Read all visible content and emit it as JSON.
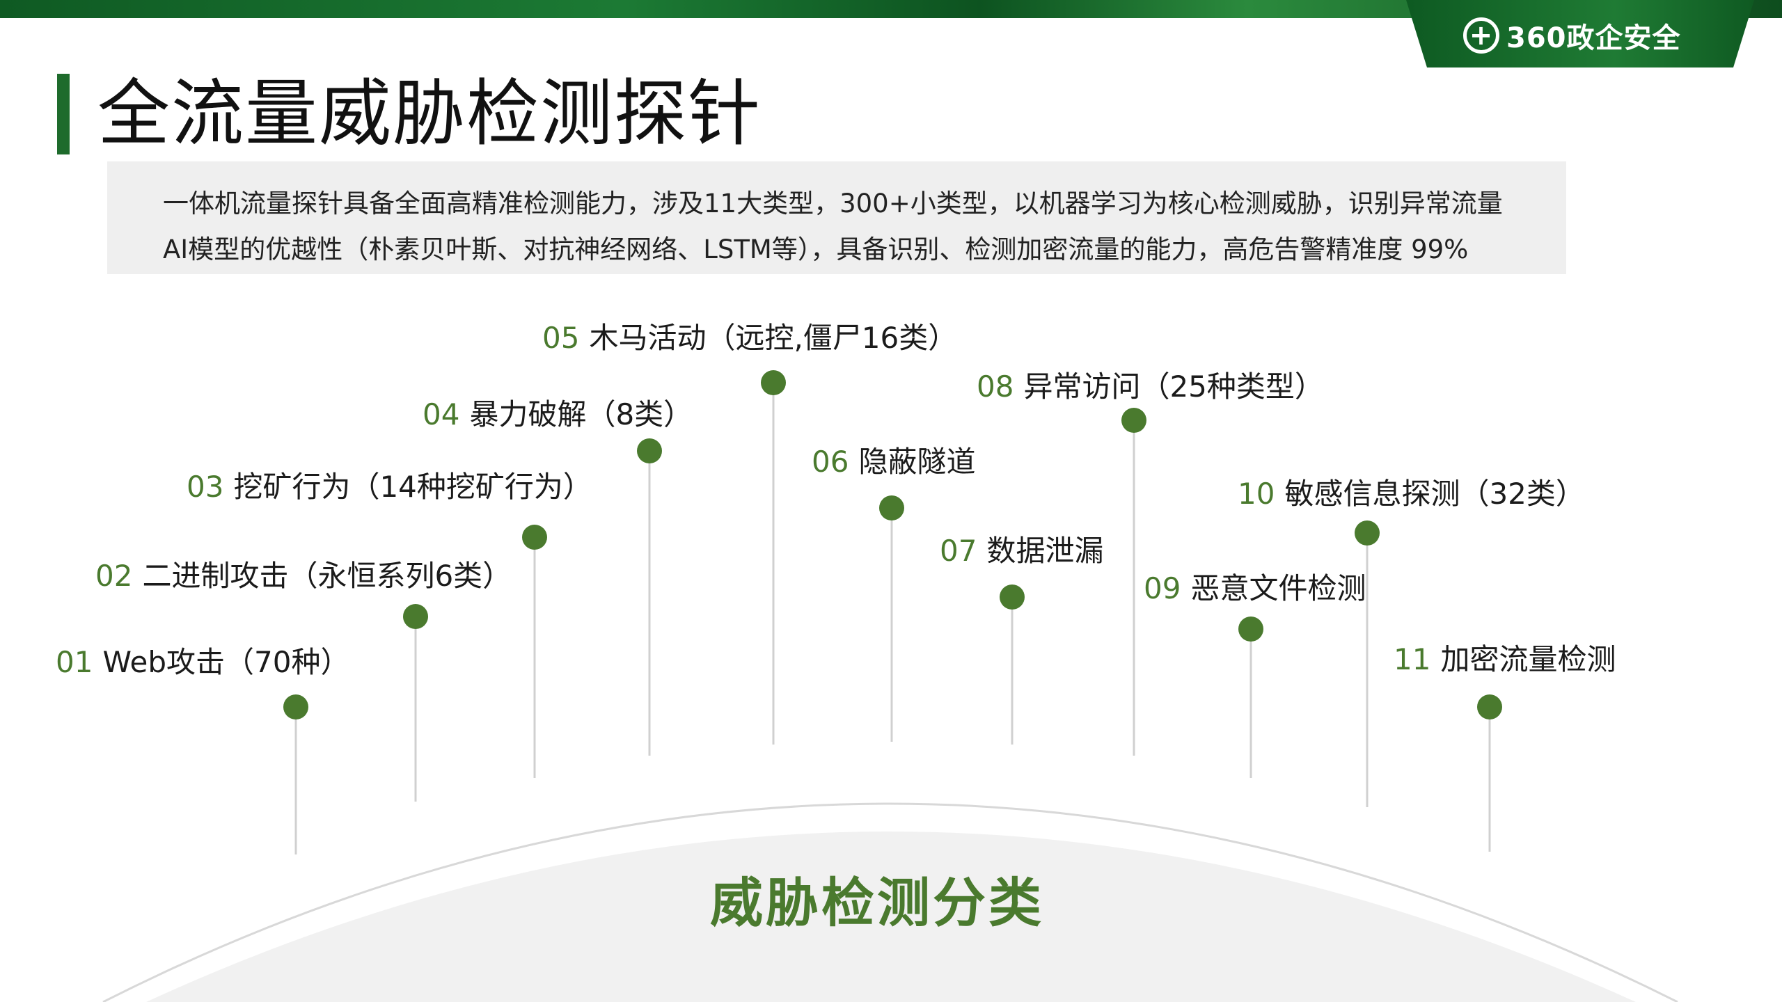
{
  "brand": {
    "logo_text": "360政企安全",
    "logo_symbol": "+"
  },
  "title": "全流量威胁检测探针",
  "summary": {
    "line1": "一体机流量探针具备全面高精准检测能力，涉及11大类型，300+小类型，以机器学习为核心检测威胁，识别异常流量",
    "line2": "AI模型的优越性（朴素贝叶斯、对抗神经网络、LSTM等），具备识别、检测加密流量的能力，高危告警精准度 99%"
  },
  "categories": [
    {
      "num": "01",
      "text": "Web攻击（70种）"
    },
    {
      "num": "02",
      "text": "二进制攻击（永恒系列6类）"
    },
    {
      "num": "03",
      "text": "挖矿行为（14种挖矿行为）"
    },
    {
      "num": "04",
      "text": "暴力破解（8类）"
    },
    {
      "num": "05",
      "text": "木马活动（远控,僵尸16类）"
    },
    {
      "num": "06",
      "text": "隐蔽隧道"
    },
    {
      "num": "07",
      "text": "数据泄漏"
    },
    {
      "num": "08",
      "text": "异常访问（25种类型）"
    },
    {
      "num": "09",
      "text": "恶意文件检测"
    },
    {
      "num": "10",
      "text": "敏感信息探测（32类）"
    },
    {
      "num": "11",
      "text": "加密流量检测"
    }
  ],
  "center_title": "威胁检测分类",
  "colors": {
    "accent_green": "#4a7a2e",
    "dark_green": "#1e6b2c",
    "summary_bg": "#efefef"
  }
}
